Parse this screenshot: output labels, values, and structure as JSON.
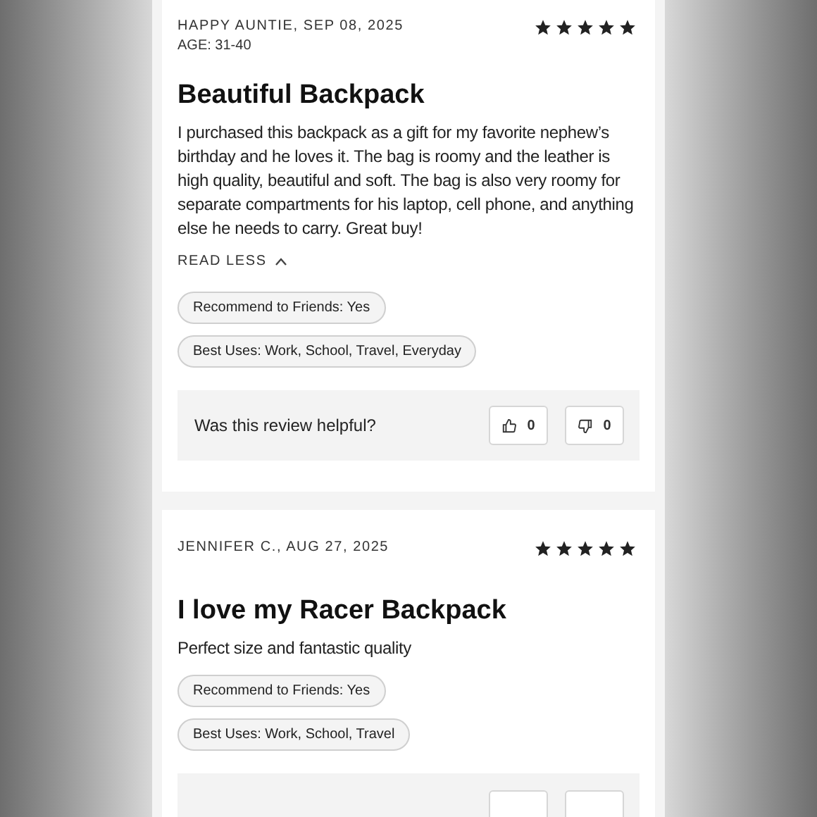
{
  "reviews": [
    {
      "author": "HAPPY AUNTIE, SEP 08, 2025",
      "age": "AGE: 31-40",
      "stars": 5,
      "title": "Beautiful Backpack",
      "body": "I purchased this backpack as a gift for my favorite nephew’s birthday and he loves it. The bag is roomy and the leather is high quality, beautiful and soft. The bag is also very roomy for separate compartments for his laptop, cell phone, and anything else he needs to carry. Great buy!",
      "toggle": "READ LESS",
      "expanded": true,
      "tags": [
        "Recommend to Friends: Yes",
        "Best Uses: Work, School, Travel, Everyday"
      ],
      "helpful": {
        "question": "Was this review helpful?",
        "up": "0",
        "down": "0"
      }
    },
    {
      "author": "JENNIFER C., AUG 27, 2025",
      "stars": 5,
      "title": "I love my Racer Backpack",
      "body": "Perfect size and fantastic quality",
      "tags": [
        "Recommend to Friends: Yes",
        "Best Uses: Work, School, Travel"
      ]
    }
  ]
}
